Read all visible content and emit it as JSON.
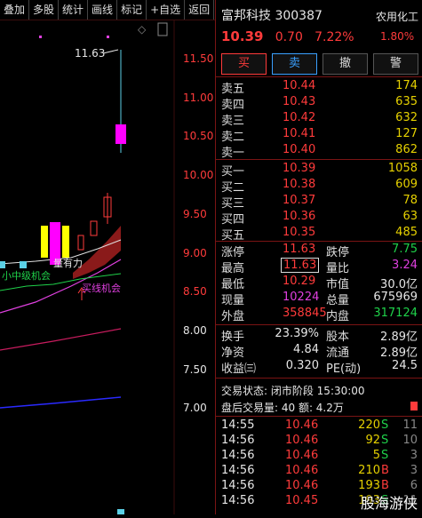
{
  "toolbar": [
    "叠加",
    "多股",
    "统计",
    "画线",
    "标记",
    "+自选",
    "返回"
  ],
  "chart": {
    "y_axis_labels": [
      "11.50",
      "11.00",
      "10.50",
      "10.00",
      "9.50",
      "9.00",
      "8.50",
      "8.00",
      "7.50",
      "7.00"
    ],
    "annotations": {
      "high_marker": "11.63",
      "pattern_label": "量有力",
      "signal_label": "小中级机会",
      "buy_label": "买线机会"
    },
    "colors": {
      "up": "#ff3b3b",
      "down": "#1fd14a",
      "ma1": "#e0e0e0",
      "ma2": "#e040e0",
      "ma3": "#c81c5e",
      "ma4": "#2a2aff"
    }
  },
  "header": {
    "name": "富邦科技",
    "code": "300387",
    "sector": "农用化工",
    "price": "10.39",
    "change": "0.70",
    "pct": "7.22%",
    "sector_pct": "1.80%"
  },
  "actions": [
    "买",
    "卖",
    "撤",
    "警"
  ],
  "asks": [
    {
      "label": "卖五",
      "price": "10.44",
      "vol": "174"
    },
    {
      "label": "卖四",
      "price": "10.43",
      "vol": "635"
    },
    {
      "label": "卖三",
      "price": "10.42",
      "vol": "632"
    },
    {
      "label": "卖二",
      "price": "10.41",
      "vol": "127"
    },
    {
      "label": "卖一",
      "price": "10.40",
      "vol": "862"
    }
  ],
  "bids": [
    {
      "label": "买一",
      "price": "10.39",
      "vol": "1058"
    },
    {
      "label": "买二",
      "price": "10.38",
      "vol": "609"
    },
    {
      "label": "买三",
      "price": "10.37",
      "vol": "78"
    },
    {
      "label": "买四",
      "price": "10.36",
      "vol": "63"
    },
    {
      "label": "买五",
      "price": "10.35",
      "vol": "485"
    }
  ],
  "stats": {
    "zt_k": "涨停",
    "zt_v": "11.63",
    "dt_k": "跌停",
    "dt_v": "7.75",
    "zg_k": "最高",
    "zg_v": "11.63",
    "lb_k": "量比",
    "lb_v": "3.24",
    "zd_k": "最低",
    "zd_v": "10.29",
    "sz_k": "市值",
    "sz_v": "30.0亿",
    "xl_k": "现量",
    "xl_v": "10224",
    "zl_k": "总量",
    "zl_v": "675969",
    "wp_k": "外盘",
    "wp_v": "358845",
    "np_k": "内盘",
    "np_v": "317124",
    "hs_k": "换手",
    "hs_v": "23.39%",
    "gb_k": "股本",
    "gb_v": "2.89亿",
    "jz_k": "净资",
    "jz_v": "4.84",
    "lt_k": "流通",
    "lt_v": "2.89亿",
    "sy_k": "收益㈢",
    "sy_v": "0.320",
    "pe_k": "PE(动)",
    "pe_v": "24.5"
  },
  "status": {
    "line1": "交易状态: 闭市阶段 15:30:00",
    "line2": "盘后交易量: 40  额: 4.2万"
  },
  "ticks": [
    {
      "time": "14:55",
      "price": "10.46",
      "vol": "220",
      "side": "S",
      "count": "11"
    },
    {
      "time": "14:56",
      "price": "10.46",
      "vol": "92",
      "side": "S",
      "count": "10"
    },
    {
      "time": "14:56",
      "price": "10.46",
      "vol": "5",
      "side": "S",
      "count": "3"
    },
    {
      "time": "14:56",
      "price": "10.46",
      "vol": "210",
      "side": "B",
      "count": "3"
    },
    {
      "time": "14:56",
      "price": "10.46",
      "vol": "193",
      "side": "B",
      "count": "6"
    },
    {
      "time": "14:56",
      "price": "10.45",
      "vol": "193",
      "side": "S",
      "count": "11"
    }
  ],
  "watermark": "股海游侠"
}
